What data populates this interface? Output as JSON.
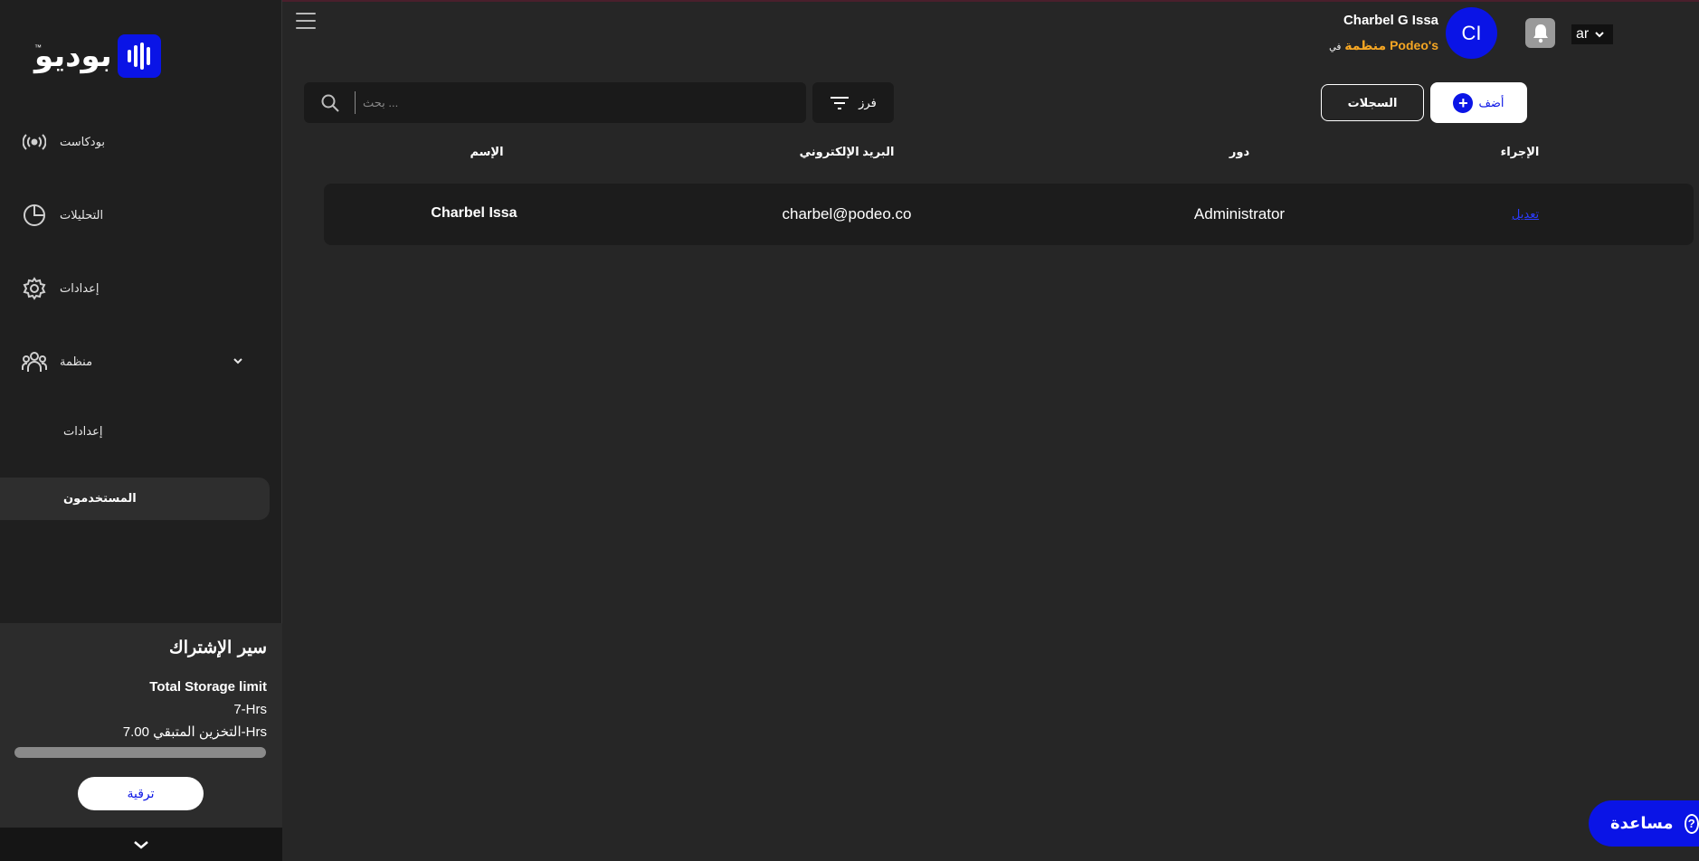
{
  "brand": {
    "name": "بوديو",
    "tm": "™",
    "color": "#0a14e6"
  },
  "sidebar": {
    "items": [
      {
        "label": "بودكاست",
        "icon": "podcast-broadcast-icon"
      },
      {
        "label": "التحليلات",
        "icon": "pie-chart-icon"
      },
      {
        "label": "إعدادات",
        "icon": "gear-icon"
      },
      {
        "label": "منظمة",
        "icon": "team-icon"
      }
    ],
    "sub_items": [
      {
        "label": "إعدادات"
      },
      {
        "label": "المستخدمون",
        "active": true
      }
    ]
  },
  "subscription": {
    "title": "سير الإشتراك",
    "storage_label": "Total Storage limit",
    "storage_total": "7-Hrs",
    "remaining": "التخزين المتبقي 7.00-Hrs",
    "used_fraction": 0,
    "upgrade_label": "ترقية"
  },
  "header": {
    "user_name": "Charbel G Issa",
    "org_name": "منظمة Podeo's",
    "org_prefix": "في",
    "avatar_initials": "CI",
    "language": "ar"
  },
  "toolbar": {
    "search_placeholder": "بحث ...",
    "sort_label": "فرز",
    "logs_label": "السجلات",
    "add_label": "أضف"
  },
  "table": {
    "columns": [
      "الإسم",
      "البريد الإلكتروني",
      "دور",
      "الإجراء"
    ],
    "rows": [
      {
        "name": "Charbel Issa",
        "email": "charbel@podeo.co",
        "role": "Administrator",
        "action": "تعديل"
      }
    ]
  },
  "help": {
    "label": "مساعدة"
  }
}
